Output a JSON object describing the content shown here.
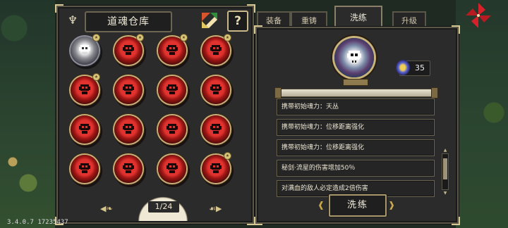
{
  "version_text": "3.4.0.7 17235437",
  "left_panel": {
    "title": "道魂仓库",
    "header_icon": "soul-rack-icon",
    "sort_icon": "sort-icon",
    "help_label": "?",
    "orbs": [
      {
        "kind": "grey",
        "badge": true
      },
      {
        "kind": "red",
        "badge": true
      },
      {
        "kind": "red",
        "badge": true
      },
      {
        "kind": "red",
        "badge": true
      },
      {
        "kind": "red",
        "badge": true
      },
      {
        "kind": "red",
        "badge": false
      },
      {
        "kind": "red",
        "badge": false
      },
      {
        "kind": "red",
        "badge": false
      },
      {
        "kind": "red",
        "badge": false
      },
      {
        "kind": "red",
        "badge": false
      },
      {
        "kind": "red",
        "badge": false
      },
      {
        "kind": "red",
        "badge": false
      },
      {
        "kind": "red",
        "badge": false
      },
      {
        "kind": "red",
        "badge": false
      },
      {
        "kind": "red",
        "badge": false
      },
      {
        "kind": "red",
        "badge": true
      }
    ],
    "pager": {
      "text": "1/24",
      "prev_icon": "arrow-left-icon",
      "next_icon": "arrow-right-icon"
    }
  },
  "tabs": [
    {
      "label": "装备",
      "active": false
    },
    {
      "label": "重铸",
      "active": false
    },
    {
      "label": "洗练",
      "active": true
    },
    {
      "label": "升级",
      "active": false
    }
  ],
  "right_panel": {
    "currency": {
      "icon": "soul-gem-icon",
      "value": "35"
    },
    "attributes": [
      "携带初始魂力：天丛",
      "携带初始魂力：位移距离强化",
      "携带初始魂力：位移距离强化",
      "秘剑·流星的伤害增加50％",
      "对满血的敌人必定造成2倍伤害"
    ],
    "reroll_label": "洗练"
  },
  "colors": {
    "accent": "#c8b27a",
    "orb_red": "#e0322e",
    "panel": "#2b2b2b"
  }
}
